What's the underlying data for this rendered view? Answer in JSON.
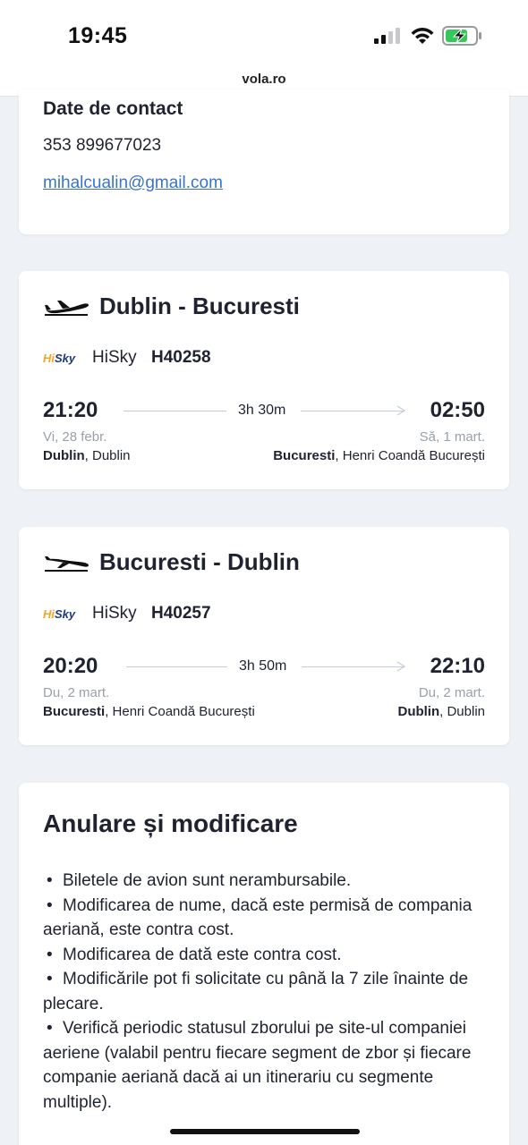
{
  "status_bar": {
    "time": "19:45"
  },
  "browser": {
    "url": "vola.ro"
  },
  "contact": {
    "title": "Date de contact",
    "phone": "353 899677023",
    "email": "mihalcualin@gmail.com"
  },
  "flights": [
    {
      "route": "Dublin - Bucuresti",
      "airline_logo_hi": "Hi",
      "airline_logo_sky": "Sky",
      "airline": "HiSky",
      "number": "H40258",
      "dep_time": "21:20",
      "arr_time": "02:50",
      "duration": "3h 30m",
      "dep_date": "Vi, 28 febr.",
      "arr_date": "Să, 1 mart.",
      "dep_city": "Dublin",
      "dep_airport": ", Dublin",
      "arr_city": "Bucuresti",
      "arr_airport": ", Henri Coandă București"
    },
    {
      "route": "Bucuresti - Dublin",
      "airline_logo_hi": "Hi",
      "airline_logo_sky": "Sky",
      "airline": "HiSky",
      "number": "H40257",
      "dep_time": "20:20",
      "arr_time": "22:10",
      "duration": "3h 50m",
      "dep_date": "Du, 2 mart.",
      "arr_date": "Du, 2 mart.",
      "dep_city": "Bucuresti",
      "dep_airport": ", Henri Coandă București",
      "arr_city": "Dublin",
      "arr_airport": ", Dublin"
    }
  ],
  "cancellation": {
    "title": "Anulare și modificare",
    "rules": [
      "Biletele de avion sunt nerambursabile.",
      "Modificarea de nume, dacă este permisă de compania aeriană, este contra cost.",
      "Modificarea de dată este contra cost.",
      "Modificările pot fi solicitate cu până la 7 zile înainte de plecare.",
      "Verifică periodic statusul zborului pe site-ul companiei aeriene (valabil pentru fiecare segment de zbor și fiecare companie aeriană dacă ai un itinerariu cu segmente multiple)."
    ]
  },
  "colors": {
    "link": "#3b73c9",
    "muted_text": "#9aa0aa",
    "logo_orange": "#f5a524",
    "logo_navy": "#1e3a78",
    "page_bg": "#eef1f5"
  }
}
